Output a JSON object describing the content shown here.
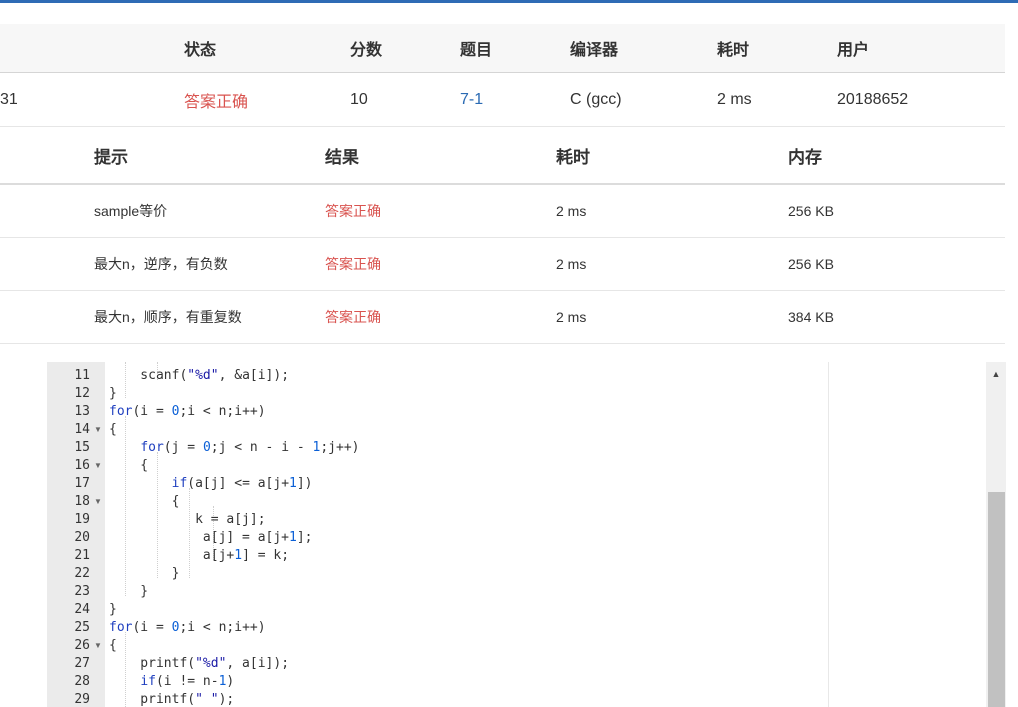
{
  "submission": {
    "headers": {
      "status": "状态",
      "score": "分数",
      "problem": "题目",
      "compiler": "编译器",
      "time": "耗时",
      "user": "用户"
    },
    "row": {
      "id": "31",
      "status": "答案正确",
      "score": "10",
      "problem": "7-1",
      "compiler": "C (gcc)",
      "time": "2 ms",
      "user": "20188652"
    }
  },
  "cases": {
    "headers": {
      "hint": "提示",
      "result": "结果",
      "time": "耗时",
      "memory": "内存"
    },
    "rows": [
      {
        "hint": "sample等价",
        "result": "答案正确",
        "time": "2 ms",
        "memory": "256 KB"
      },
      {
        "hint": "最大n，逆序，有负数",
        "result": "答案正确",
        "time": "2 ms",
        "memory": "256 KB"
      },
      {
        "hint": "最大n，顺序，有重复数",
        "result": "答案正确",
        "time": "2 ms",
        "memory": "384 KB"
      }
    ]
  },
  "code": {
    "lines": [
      {
        "n": "11",
        "fold": false,
        "tokens": [
          {
            "t": "    scanf("
          },
          {
            "t": "\"%d\"",
            "c": "str"
          },
          {
            "t": ", &a[i]);"
          }
        ]
      },
      {
        "n": "12",
        "fold": false,
        "tokens": [
          {
            "t": "}"
          }
        ]
      },
      {
        "n": "13",
        "fold": false,
        "tokens": [
          {
            "t": "for",
            "c": "kw"
          },
          {
            "t": "(i = "
          },
          {
            "t": "0",
            "c": "num"
          },
          {
            "t": ";i < n;i++)"
          }
        ]
      },
      {
        "n": "14",
        "fold": true,
        "tokens": [
          {
            "t": "{"
          }
        ]
      },
      {
        "n": "15",
        "fold": false,
        "tokens": [
          {
            "t": "    "
          },
          {
            "t": "for",
            "c": "kw"
          },
          {
            "t": "(j = "
          },
          {
            "t": "0",
            "c": "num"
          },
          {
            "t": ";j < n - i - "
          },
          {
            "t": "1",
            "c": "num"
          },
          {
            "t": ";j++)"
          }
        ]
      },
      {
        "n": "16",
        "fold": true,
        "tokens": [
          {
            "t": "    {"
          }
        ]
      },
      {
        "n": "17",
        "fold": false,
        "tokens": [
          {
            "t": "        "
          },
          {
            "t": "if",
            "c": "kw"
          },
          {
            "t": "(a[j] <= a[j+"
          },
          {
            "t": "1",
            "c": "num"
          },
          {
            "t": "])"
          }
        ]
      },
      {
        "n": "18",
        "fold": true,
        "tokens": [
          {
            "t": "        {"
          }
        ]
      },
      {
        "n": "19",
        "fold": false,
        "tokens": [
          {
            "t": "           k = a[j];"
          }
        ]
      },
      {
        "n": "20",
        "fold": false,
        "tokens": [
          {
            "t": "            a[j] = a[j+"
          },
          {
            "t": "1",
            "c": "num"
          },
          {
            "t": "];"
          }
        ]
      },
      {
        "n": "21",
        "fold": false,
        "tokens": [
          {
            "t": "            a[j+"
          },
          {
            "t": "1",
            "c": "num"
          },
          {
            "t": "] = k;"
          }
        ]
      },
      {
        "n": "22",
        "fold": false,
        "tokens": [
          {
            "t": "        }"
          }
        ]
      },
      {
        "n": "23",
        "fold": false,
        "tokens": [
          {
            "t": "    }"
          }
        ]
      },
      {
        "n": "24",
        "fold": false,
        "tokens": [
          {
            "t": "}"
          }
        ]
      },
      {
        "n": "25",
        "fold": false,
        "tokens": [
          {
            "t": "for",
            "c": "kw"
          },
          {
            "t": "(i = "
          },
          {
            "t": "0",
            "c": "num"
          },
          {
            "t": ";i < n;i++)"
          }
        ]
      },
      {
        "n": "26",
        "fold": true,
        "tokens": [
          {
            "t": "{"
          }
        ]
      },
      {
        "n": "27",
        "fold": false,
        "tokens": [
          {
            "t": "    printf("
          },
          {
            "t": "\"%d\"",
            "c": "str"
          },
          {
            "t": ", a[i]);"
          }
        ]
      },
      {
        "n": "28",
        "fold": false,
        "tokens": [
          {
            "t": "    "
          },
          {
            "t": "if",
            "c": "kw"
          },
          {
            "t": "(i != n-"
          },
          {
            "t": "1",
            "c": "num"
          },
          {
            "t": ")"
          }
        ]
      },
      {
        "n": "29",
        "fold": false,
        "tokens": [
          {
            "t": "    printf("
          },
          {
            "t": "\" \"",
            "c": "str"
          },
          {
            "t": ");"
          }
        ]
      }
    ]
  },
  "colors": {
    "accent": "#2e6bb5",
    "ok": "#d9534f",
    "link": "#2a6ab3"
  }
}
